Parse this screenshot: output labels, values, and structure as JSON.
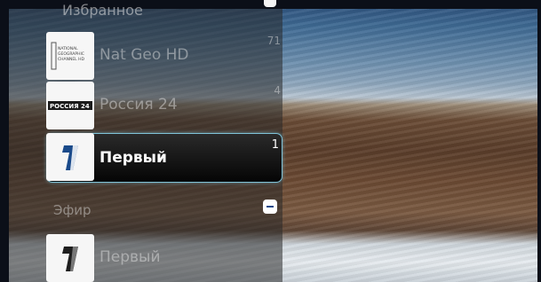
{
  "group_header": "Избранное",
  "channels": [
    {
      "name": "Nat Geo HD",
      "number": "71",
      "logo_text": "NATIONAL GEOGRAPHIC CHANNEL HD",
      "state": "normal"
    },
    {
      "name": "Россия 24",
      "number": "4",
      "logo_text": "РОССИЯ 24",
      "state": "normal"
    },
    {
      "name": "Первый",
      "number": "1",
      "logo_text": "1",
      "state": "selected"
    }
  ],
  "section": {
    "label": "Эфир",
    "toggle_icon": "minus-icon"
  },
  "section_channels": [
    {
      "name": "Первый",
      "logo_text": "1"
    }
  ],
  "colors": {
    "highlight_border": "#7fc3d8",
    "first_channel_blue": "#1a4a8a"
  }
}
